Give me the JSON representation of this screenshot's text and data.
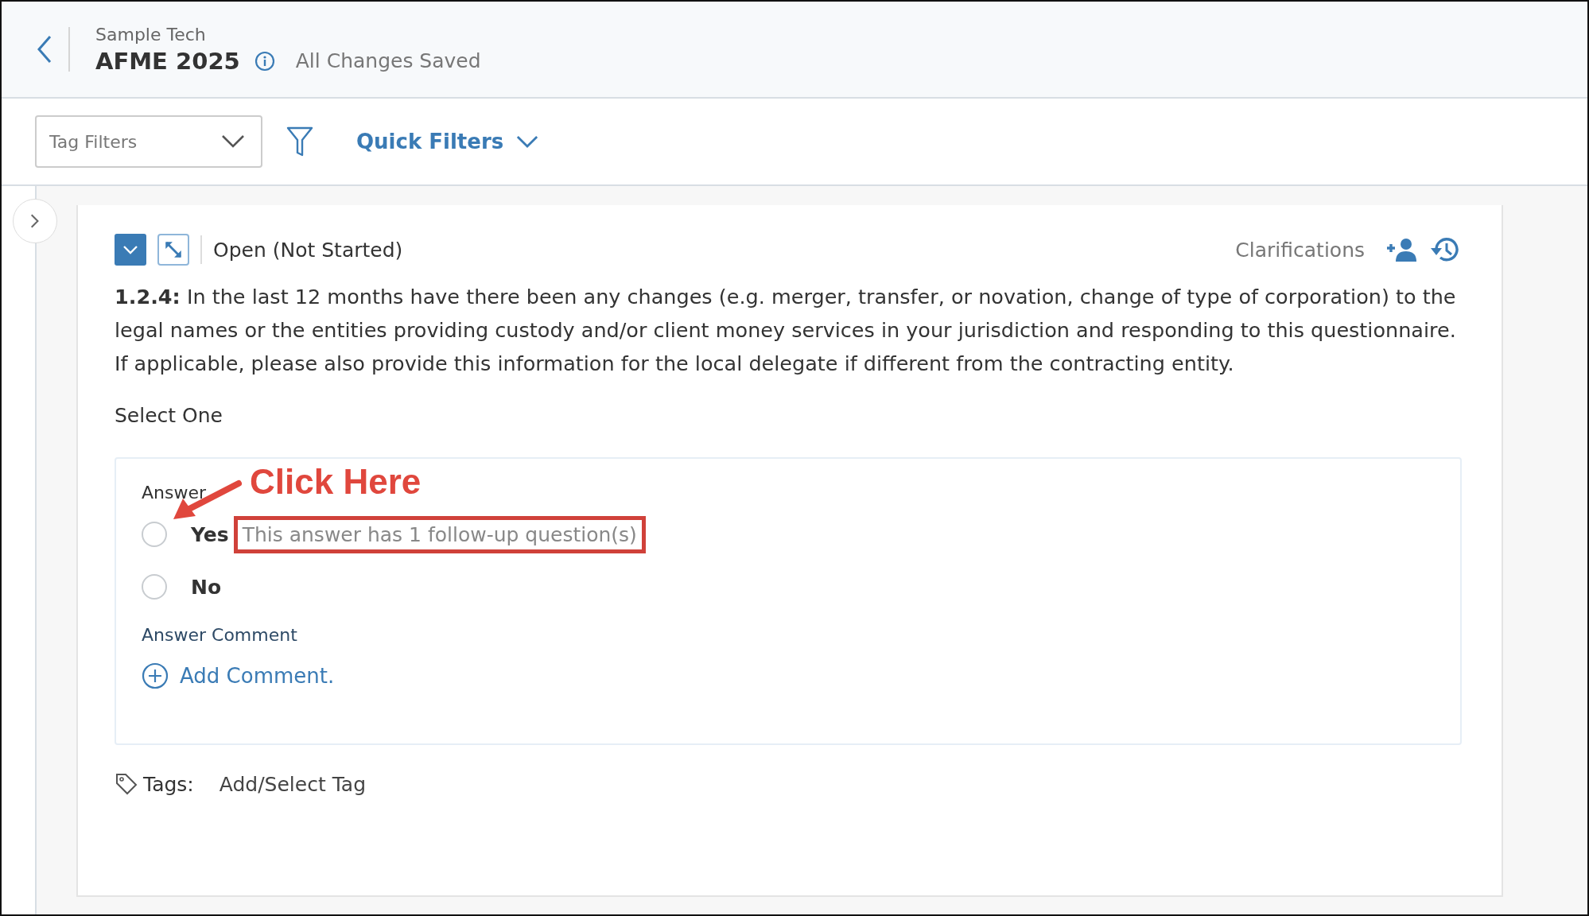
{
  "header": {
    "company": "Sample Tech",
    "title": "AFME 2025",
    "save_status": "All Changes Saved"
  },
  "filters": {
    "tag_filter": {
      "placeholder": "Tag Filters"
    },
    "quick_filters": "Quick Filters"
  },
  "sidebar": {
    "expanded": false
  },
  "question": {
    "status": "Open (Not Started)",
    "clarifications": "Clarifications",
    "number": "1.2.4:",
    "text": "In the last 12 months have there been any changes (e.g. merger, transfer, or novation, change of type of corporation) to the legal names or the entities providing custody and/or client money services in your jurisdiction and responding to this questionnaire. If applicable, please also provide this information for the local delegate if different from the contracting entity.",
    "instruction": "Select One",
    "answer": {
      "label": "Answer",
      "options": [
        {
          "label": "Yes",
          "selected": false,
          "note": "This answer has 1 follow-up question(s)"
        },
        {
          "label": "No",
          "selected": false
        }
      ],
      "comment_label": "Answer Comment",
      "add_comment": "Add Comment."
    },
    "tags": {
      "label": "Tags:",
      "action": "Add/Select Tag"
    }
  },
  "annotation": {
    "text": "Click Here"
  }
}
